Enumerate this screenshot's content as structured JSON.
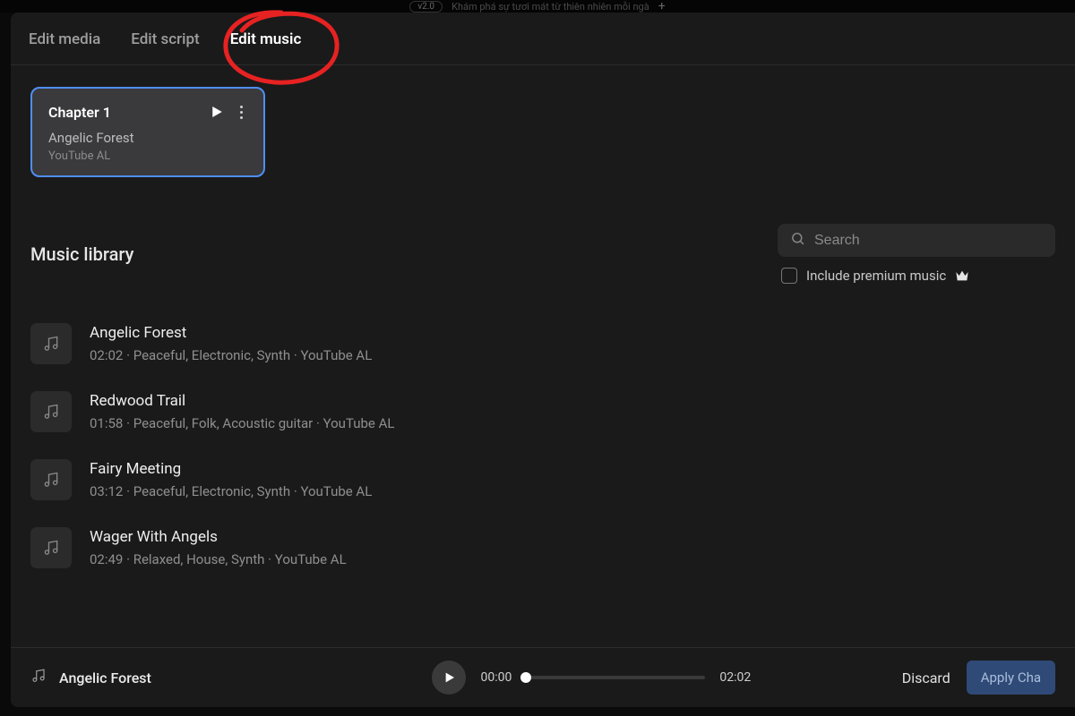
{
  "topstrip": {
    "version": "v2.0",
    "tab_title": "Khám phá sự tươi mát từ thiên nhiên mỗi ngà"
  },
  "tabs": {
    "media": "Edit media",
    "script": "Edit script",
    "music": "Edit music"
  },
  "chapter": {
    "title": "Chapter 1",
    "track": "Angelic Forest",
    "source": "YouTube AL"
  },
  "library": {
    "title": "Music library",
    "search_placeholder": "Search",
    "premium_label": "Include premium music"
  },
  "tracks": [
    {
      "title": "Angelic Forest",
      "meta": "02:02 · Peaceful, Electronic, Synth · YouTube AL"
    },
    {
      "title": "Redwood Trail",
      "meta": "01:58 · Peaceful, Folk, Acoustic guitar · YouTube AL"
    },
    {
      "title": "Fairy Meeting",
      "meta": "03:12 · Peaceful, Electronic, Synth · YouTube AL"
    },
    {
      "title": "Wager With Angels",
      "meta": "02:49 · Relaxed, House, Synth · YouTube AL"
    }
  ],
  "player": {
    "now_playing": "Angelic Forest",
    "elapsed": "00:00",
    "duration": "02:02",
    "discard": "Discard",
    "apply": "Apply Cha"
  }
}
